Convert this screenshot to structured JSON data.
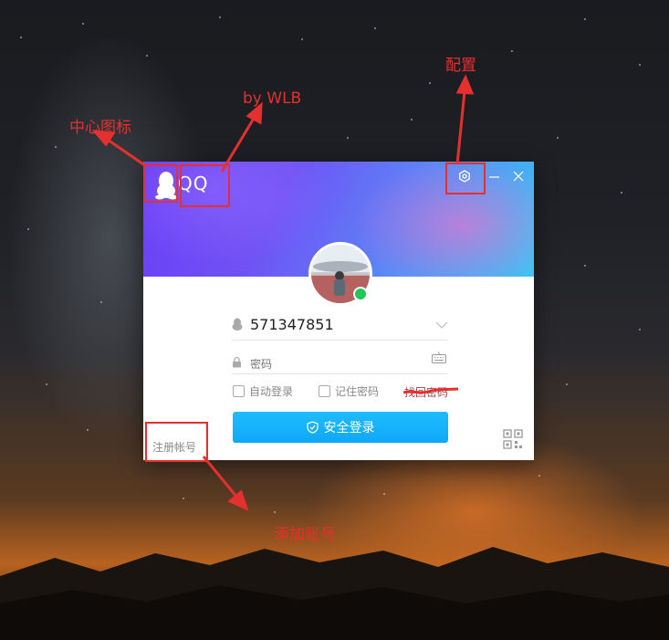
{
  "window": {
    "app_title": "QQ",
    "controls": {
      "settings": "gear-icon",
      "minimize": "minimize-icon",
      "close": "close-icon"
    }
  },
  "login": {
    "account_value": "571347851",
    "password_placeholder": "密码",
    "auto_login_label": "自动登录",
    "remember_label": "记住密码",
    "retrieve_label": "找回密码",
    "login_button_label": "安全登录",
    "register_label": "注册帐号"
  },
  "annotations": {
    "center_icon": "中心图标",
    "by": "by WLB",
    "config": "配置",
    "add_account": "添加账号"
  },
  "colors": {
    "annotation_red": "#e53030",
    "login_blue": "#12b7f5",
    "online_green": "#22c65b"
  }
}
